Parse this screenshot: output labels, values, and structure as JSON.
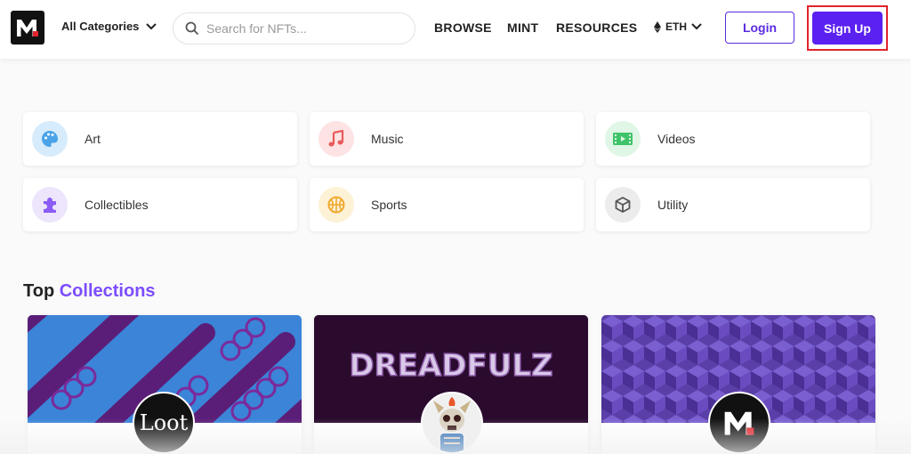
{
  "header": {
    "logo_icon": "m-logo-icon",
    "categories_label": "All Categories",
    "search_placeholder": "Search for NFTs...",
    "nav": [
      "BROWSE",
      "MINT",
      "RESOURCES"
    ],
    "currency": "ETH",
    "login_label": "Login",
    "signup_label": "Sign Up"
  },
  "categories": [
    {
      "label": "Art",
      "icon": "palette-icon",
      "color": "#d6ebfb"
    },
    {
      "label": "Music",
      "icon": "music-note-icon",
      "color": "#fde3e3"
    },
    {
      "label": "Videos",
      "icon": "film-icon",
      "color": "#e0f6e6"
    },
    {
      "label": "Collectibles",
      "icon": "puzzle-icon",
      "color": "#ece5fb"
    },
    {
      "label": "Sports",
      "icon": "basketball-icon",
      "color": "#fdf1d6"
    },
    {
      "label": "Utility",
      "icon": "cube-icon",
      "color": "#ececec"
    }
  ],
  "top_collections": {
    "title_part1": "Top",
    "title_part2": "Collections",
    "items": [
      {
        "avatar_text": "Loot",
        "banner_text": ""
      },
      {
        "avatar_text": "",
        "banner_text": "DREADFULZ"
      },
      {
        "avatar_text": "",
        "banner_text": ""
      }
    ]
  },
  "colors": {
    "accent": "#5b21f0",
    "highlight": "#e0242c",
    "title_accent": "#7c4dff"
  }
}
